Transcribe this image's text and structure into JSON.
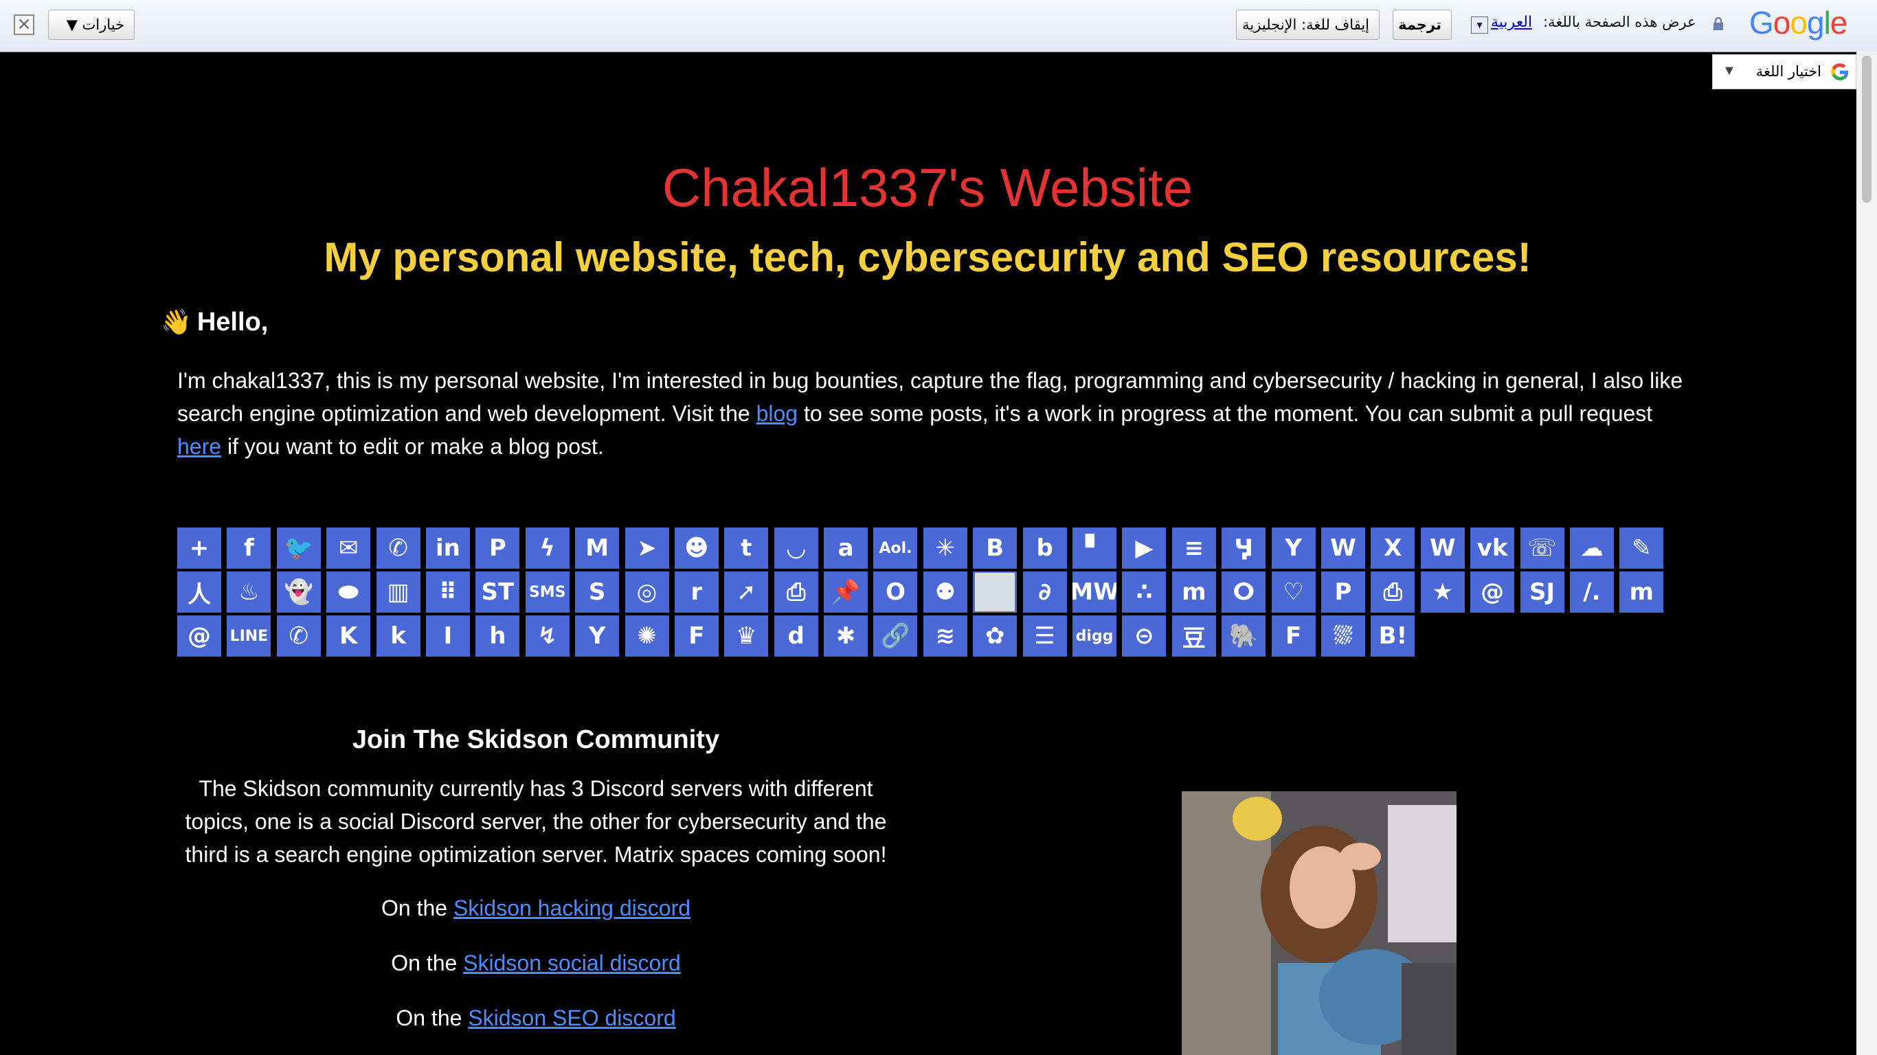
{
  "translate_bar": {
    "close_icon": "close-icon",
    "options_label": "خيارات ▼",
    "stop_label": "إيقاف للغة: الإنجليزية",
    "translate_label": "ترجمة",
    "language_link": "العربية",
    "prompt": "عرض هذه الصفحة باللغة:",
    "logo": "Google"
  },
  "lang_widget": {
    "label": "اختيار اللغة",
    "arrow": "▼"
  },
  "header": {
    "title": "Chakal1337's Website",
    "subtitle": "My personal website, tech, cybersecurity and SEO resources!"
  },
  "hello": {
    "emoji": "👋",
    "text": "Hello,"
  },
  "intro": {
    "part1": "I'm chakal1337, this is my personal website, I'm interested in bug bounties, capture the flag, programming and cybersecurity / hacking in general, I also like search engine optimization and web development. Visit the ",
    "blog_link": "blog",
    "part2": " to see some posts, it's a work in progress at the moment. You can submit a pull request ",
    "here_link": "here",
    "part3": " if you want to edit or make a blog post."
  },
  "share_icons": [
    {
      "name": "addtoany",
      "glyph": "+"
    },
    {
      "name": "facebook",
      "glyph": "f"
    },
    {
      "name": "twitter",
      "glyph": "🐦"
    },
    {
      "name": "email",
      "glyph": "✉"
    },
    {
      "name": "whatsapp",
      "glyph": "✆"
    },
    {
      "name": "linkedin",
      "glyph": "in"
    },
    {
      "name": "pinterest",
      "glyph": "P"
    },
    {
      "name": "messenger",
      "glyph": "ϟ"
    },
    {
      "name": "gmail",
      "glyph": "M"
    },
    {
      "name": "telegram",
      "glyph": "➤"
    },
    {
      "name": "reddit",
      "glyph": "☻"
    },
    {
      "name": "tumblr",
      "glyph": "t"
    },
    {
      "name": "pocket",
      "glyph": "◡"
    },
    {
      "name": "amazon",
      "glyph": "a"
    },
    {
      "name": "aol",
      "glyph": "Aol."
    },
    {
      "name": "diaspora",
      "glyph": "✳"
    },
    {
      "name": "blogger",
      "glyph": "B"
    },
    {
      "name": "bibsonomy",
      "glyph": "b"
    },
    {
      "name": "blogmarks",
      "glyph": "▘"
    },
    {
      "name": "bookmarks",
      "glyph": "▶"
    },
    {
      "name": "calendar",
      "glyph": "≡"
    },
    {
      "name": "yandex",
      "glyph": "Ӌ"
    },
    {
      "name": "yahoo",
      "glyph": "Y"
    },
    {
      "name": "wykop",
      "glyph": "W"
    },
    {
      "name": "xing",
      "glyph": "X"
    },
    {
      "name": "wordpress",
      "glyph": "W"
    },
    {
      "name": "vk",
      "glyph": "vk"
    },
    {
      "name": "viber",
      "glyph": "☏"
    },
    {
      "name": "wechat",
      "glyph": "☁"
    },
    {
      "name": "pen",
      "glyph": "✎"
    },
    {
      "name": "renren",
      "glyph": "人"
    },
    {
      "name": "tinder",
      "glyph": "♨"
    },
    {
      "name": "snapchat",
      "glyph": "👻"
    },
    {
      "name": "mendeley",
      "glyph": "⬬"
    },
    {
      "name": "trello",
      "glyph": "▥"
    },
    {
      "name": "apps",
      "glyph": "⠿"
    },
    {
      "name": "symbaloo",
      "glyph": "ST"
    },
    {
      "name": "sms",
      "glyph": "SMS"
    },
    {
      "name": "skype",
      "glyph": "S"
    },
    {
      "name": "weibo",
      "glyph": "◎"
    },
    {
      "name": "rediff",
      "glyph": "r"
    },
    {
      "name": "sitejot",
      "glyph": "➚"
    },
    {
      "name": "printfriendly",
      "glyph": "⎙"
    },
    {
      "name": "pinboard",
      "glyph": "📌"
    },
    {
      "name": "outlook",
      "glyph": "O"
    },
    {
      "name": "people",
      "glyph": "⚉"
    },
    {
      "name": "broken_image",
      "glyph": ""
    },
    {
      "name": "evernote_alt",
      "glyph": "∂"
    },
    {
      "name": "mewe",
      "glyph": "MW"
    },
    {
      "name": "mastodon_dots",
      "glyph": "∴"
    },
    {
      "name": "meneame",
      "glyph": "m"
    },
    {
      "name": "odnoklassniki",
      "glyph": "ⵔ"
    },
    {
      "name": "heart",
      "glyph": "♡"
    },
    {
      "name": "plurk",
      "glyph": "P"
    },
    {
      "name": "print",
      "glyph": "⎙"
    },
    {
      "name": "qzone",
      "glyph": "★"
    },
    {
      "name": "mailru",
      "glyph": "@"
    },
    {
      "name": "sj",
      "glyph": "SJ"
    },
    {
      "name": "slashdot",
      "glyph": "/."
    },
    {
      "name": "mastodon",
      "glyph": "m"
    },
    {
      "name": "mail_at",
      "glyph": "@"
    },
    {
      "name": "line",
      "glyph": "LINE"
    },
    {
      "name": "kakao",
      "glyph": "✆"
    },
    {
      "name": "kik",
      "glyph": "K"
    },
    {
      "name": "kindle",
      "glyph": "k"
    },
    {
      "name": "instapaper",
      "glyph": "I"
    },
    {
      "name": "houzz",
      "glyph": "h"
    },
    {
      "name": "hatena_alt",
      "glyph": "↯"
    },
    {
      "name": "yummly",
      "glyph": "Y"
    },
    {
      "name": "diigo",
      "glyph": "✺"
    },
    {
      "name": "flipboard_f",
      "glyph": "F"
    },
    {
      "name": "folkd",
      "glyph": "♛"
    },
    {
      "name": "douban_d",
      "glyph": "d"
    },
    {
      "name": "star",
      "glyph": "✱"
    },
    {
      "name": "link",
      "glyph": "🔗"
    },
    {
      "name": "buffer",
      "glyph": "≋"
    },
    {
      "name": "flower",
      "glyph": "✿"
    },
    {
      "name": "list",
      "glyph": "☰"
    },
    {
      "name": "digg",
      "glyph": "digg"
    },
    {
      "name": "disqus",
      "glyph": "⊝"
    },
    {
      "name": "douban",
      "glyph": "豆"
    },
    {
      "name": "evernote",
      "glyph": "🐘"
    },
    {
      "name": "flipboard",
      "glyph": "F"
    },
    {
      "name": "fark",
      "glyph": "⛆"
    },
    {
      "name": "hatena",
      "glyph": "B!"
    }
  ],
  "community": {
    "title": "Join The Skidson Community",
    "text": "The Skidson community currently has 3 Discord servers with different topics, one is a social Discord server, the other for cybersecurity and the third is a search engine optimization server. Matrix spaces coming soon!",
    "prefix": "On the",
    "hacking_link": "Skidson hacking discord",
    "social_link": "Skidson social discord",
    "seo_link": "Skidson SEO discord"
  },
  "colors": {
    "title": "#e53333",
    "subtitle": "#f4d03f",
    "link": "#4c8dff",
    "share_bg": "#4a68d6",
    "background": "#000000"
  }
}
